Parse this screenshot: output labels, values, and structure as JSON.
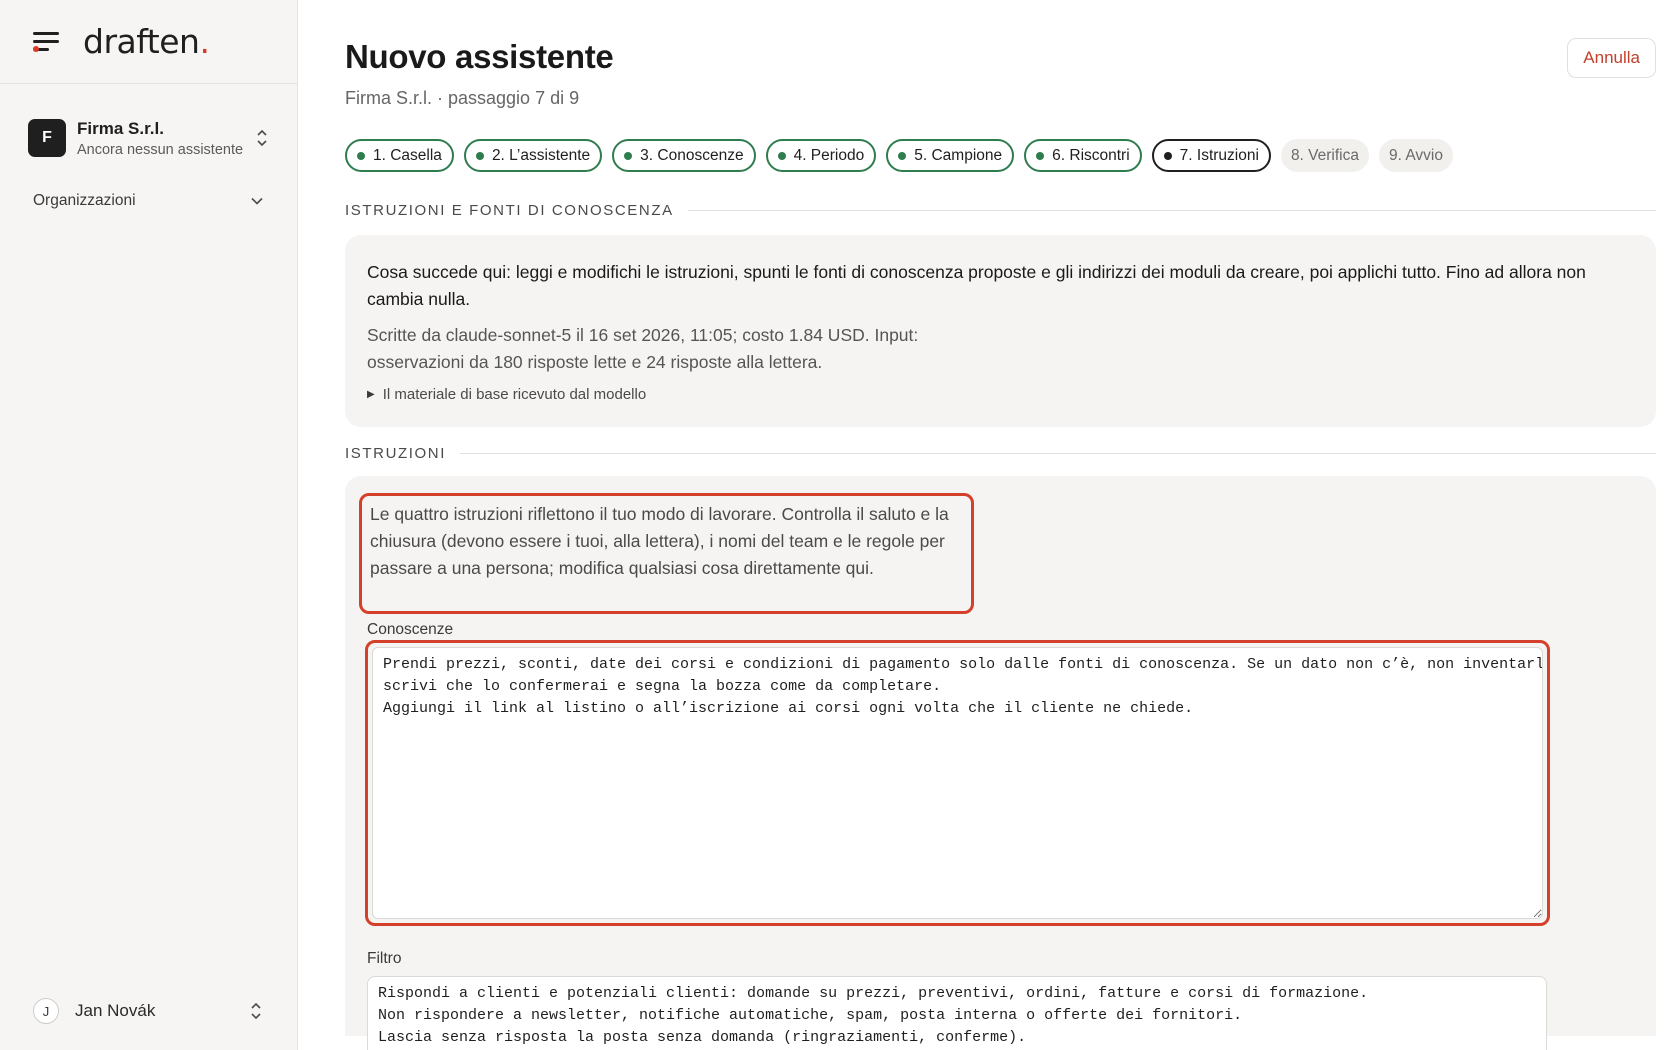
{
  "sidebar": {
    "logo_text": "draften",
    "logo_dot": ".",
    "org": {
      "initial": "F",
      "name": "Firma S.r.l.",
      "subtitle": "Ancora nessun assistente"
    },
    "section_label": "Organizzazioni",
    "user": {
      "initial": "J",
      "name": "Jan Novák"
    }
  },
  "header": {
    "title": "Nuovo assistente",
    "subtitle": "Firma S.r.l. · passaggio 7 di 9",
    "cancel_label": "Annulla"
  },
  "steps": [
    {
      "label": "1. Casella",
      "state": "done"
    },
    {
      "label": "2. L’assistente",
      "state": "done"
    },
    {
      "label": "3. Conoscenze",
      "state": "done"
    },
    {
      "label": "4. Periodo",
      "state": "done"
    },
    {
      "label": "5. Campione",
      "state": "done"
    },
    {
      "label": "6. Riscontri",
      "state": "done"
    },
    {
      "label": "7. Istruzioni",
      "state": "current"
    },
    {
      "label": "8. Verifica",
      "state": "future"
    },
    {
      "label": "9. Avvio",
      "state": "future"
    }
  ],
  "sources_section": {
    "label": "ISTRUZIONI E FONTI DI CONOSCENZA",
    "info": "Cosa succede qui: leggi e modifichi le istruzioni, spunti le fonti di conoscenza proposte e gli indirizzi dei moduli da creare, poi applichi tutto. Fino ad allora non cambia nulla.",
    "meta": "Scritte da claude-sonnet-5 il 16 set 2026, 11:05; costo 1.84 USD. Input: osservazioni da 180 risposte lette e 24 risposte alla lettera.",
    "details_label": "Il materiale di base ricevuto dal modello"
  },
  "instructions_section": {
    "label": "ISTRUZIONI",
    "intro": "Le quattro istruzioni riflettono il tuo modo di lavorare. Controlla il saluto e la chiusura (devono essere i tuoi, alla lettera), i nomi del team e le regole per passare a una persona; modifica qualsiasi cosa direttamente qui.",
    "knowledge_label": "Conoscenze",
    "knowledge_value": "Prendi prezzi, sconti, date dei corsi e condizioni di pagamento solo dalle fonti di conoscenza. Se un dato non c’è, non inventarlo:\nscrivi che lo confermerai e segna la bozza come da completare.\nAggiungi il link al listino o all’iscrizione ai corsi ogni volta che il cliente ne chiede.",
    "filter_label": "Filtro",
    "filter_value": "Rispondi a clienti e potenziali clienti: domande su prezzi, preventivi, ordini, fatture e corsi di formazione.\nNon rispondere a newsletter, notifiche automatiche, spam, posta interna o offerte dei fornitori.\nLascia senza risposta la posta senza domanda (ringraziamenti, conferme)."
  },
  "colors": {
    "accent_red": "#d5402a",
    "done_green": "#2f7d4e",
    "sidebar_bg": "#f6f5f3",
    "card_bg": "#f5f4f2"
  }
}
